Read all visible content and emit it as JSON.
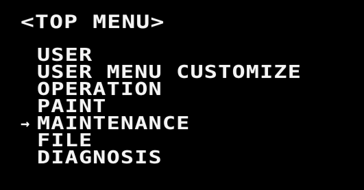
{
  "screen": {
    "title": "<TOP MENU>",
    "cursor_glyph": "→",
    "selected_index": 4,
    "items": [
      {
        "label": "USER"
      },
      {
        "label": "USER MENU CUSTOMIZE"
      },
      {
        "label": "OPERATION"
      },
      {
        "label": "PAINT"
      },
      {
        "label": "MAINTENANCE"
      },
      {
        "label": "FILE"
      },
      {
        "label": "DIAGNOSIS"
      }
    ]
  },
  "colors": {
    "background": "#000000",
    "text": "#f4f4f4"
  }
}
